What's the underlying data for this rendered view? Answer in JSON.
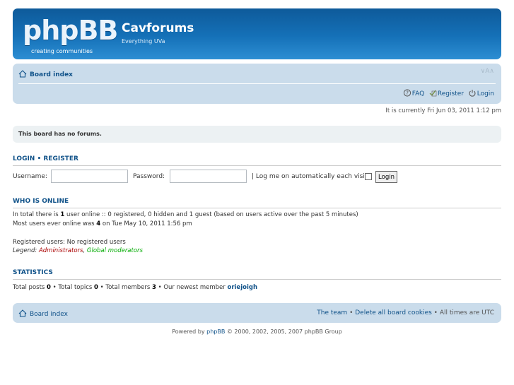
{
  "header": {
    "logo_text": "phpBB",
    "logo_tagline": "creating communities",
    "site_title": "Cavforums",
    "site_description": "Everything UVa"
  },
  "navbar": {
    "board_index": "Board index",
    "font_size_toggle": "∨A∧",
    "faq": "FAQ",
    "register": "Register",
    "login": "Login"
  },
  "current_time": "It is currently Fri Jun 03, 2011 1:12 pm",
  "notice": "This board has no forums.",
  "login_section": {
    "title_login": "LOGIN",
    "separator": "•",
    "title_register": "REGISTER",
    "username_label": "Username:",
    "password_label": "Password:",
    "autologin_label": "| Log me on automatically each visit",
    "login_button": "Login"
  },
  "who_is_online": {
    "title": "WHO IS ONLINE",
    "line1_pre": "In total there is ",
    "online_count": "1",
    "line1_post": " user online :: 0 registered, 0 hidden and 1 guest (based on users active over the past 5 minutes)",
    "line2_pre": "Most users ever online was ",
    "max_online": "4",
    "line2_post": " on Tue May 10, 2011 1:56 pm",
    "registered_users": "Registered users: No registered users",
    "legend_label": "Legend: ",
    "legend_admin": "Administrators",
    "legend_sep": ", ",
    "legend_gmod": "Global moderators"
  },
  "statistics": {
    "title": "STATISTICS",
    "posts_label": "Total posts ",
    "posts": "0",
    "topics_label": " • Total topics ",
    "topics": "0",
    "members_label": " • Total members ",
    "members": "3",
    "newest_label": " • Our newest member ",
    "newest_member": "oriejoigh"
  },
  "footer": {
    "board_index": "Board index",
    "the_team": "The team",
    "sep": " • ",
    "delete_cookies": "Delete all board cookies",
    "timezone": "All times are UTC",
    "powered_pre": "Powered by ",
    "powered_link": "phpBB",
    "powered_post": " © 2000, 2002, 2005, 2007 phpBB Group"
  },
  "colors": {
    "header_blue": "#1571b8",
    "nav_bg": "#cadceb",
    "link": "#105289",
    "admin": "#aa0000",
    "global_mod": "#00aa00"
  },
  "icons": [
    "home-icon",
    "faq-icon",
    "register-icon",
    "login-icon"
  ]
}
